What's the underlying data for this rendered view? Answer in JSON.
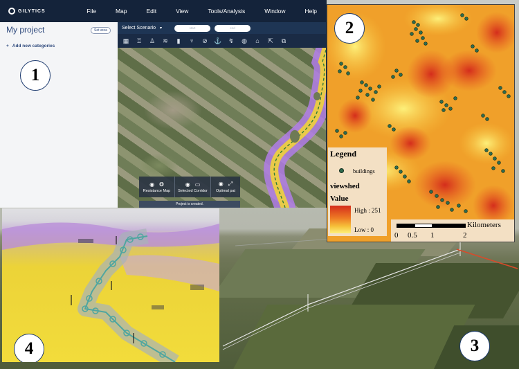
{
  "app": {
    "brand": "GILYTICS",
    "menu": [
      "File",
      "Map",
      "Edit",
      "View",
      "Tools/Analysis",
      "Window",
      "Help"
    ]
  },
  "sidebar": {
    "project_title": "My project",
    "set_area_button": "Set area",
    "add_categories": "Add new categories",
    "add_icon": "+"
  },
  "scenario_bar": {
    "label": "Select Scenario",
    "caret": "▾",
    "start_placeholder": "start",
    "end_placeholder": "end"
  },
  "toolbar_icons": [
    "map-layers-icon",
    "tower-icon",
    "walker-icon",
    "layers-stack-icon",
    "cylinder-icon",
    "pylon-icon",
    "no-entry-icon",
    "anchor-icon",
    "route-icon",
    "globe-icon",
    "pin-icon",
    "export-icon",
    "share-icon"
  ],
  "analysis_bar": {
    "items": [
      {
        "label": "Resistance Map"
      },
      {
        "label": "Selected Corridor"
      },
      {
        "label": "Optimal pat"
      }
    ]
  },
  "status_toast": "Project is created.",
  "viewshed_map": {
    "legend_title": "Legend",
    "buildings_label": "buildings",
    "layer_title": "viewshed",
    "value_title": "Value",
    "high_label": "High : 251",
    "low_label": "Low : 0",
    "scale_unit": "Kilometers",
    "scale_ticks": [
      "0",
      "0.5",
      "1",
      "2"
    ],
    "colors": {
      "high": "#d42d1c",
      "mid": "#ee7a24",
      "low": "#fdf07a",
      "buildings": "#2f6b4e"
    }
  },
  "panel_labels": [
    "1",
    "2",
    "3",
    "4"
  ],
  "colors": {
    "menubar": "#14233a",
    "corridor": "#a070e0",
    "path": "#4fa6a0"
  }
}
